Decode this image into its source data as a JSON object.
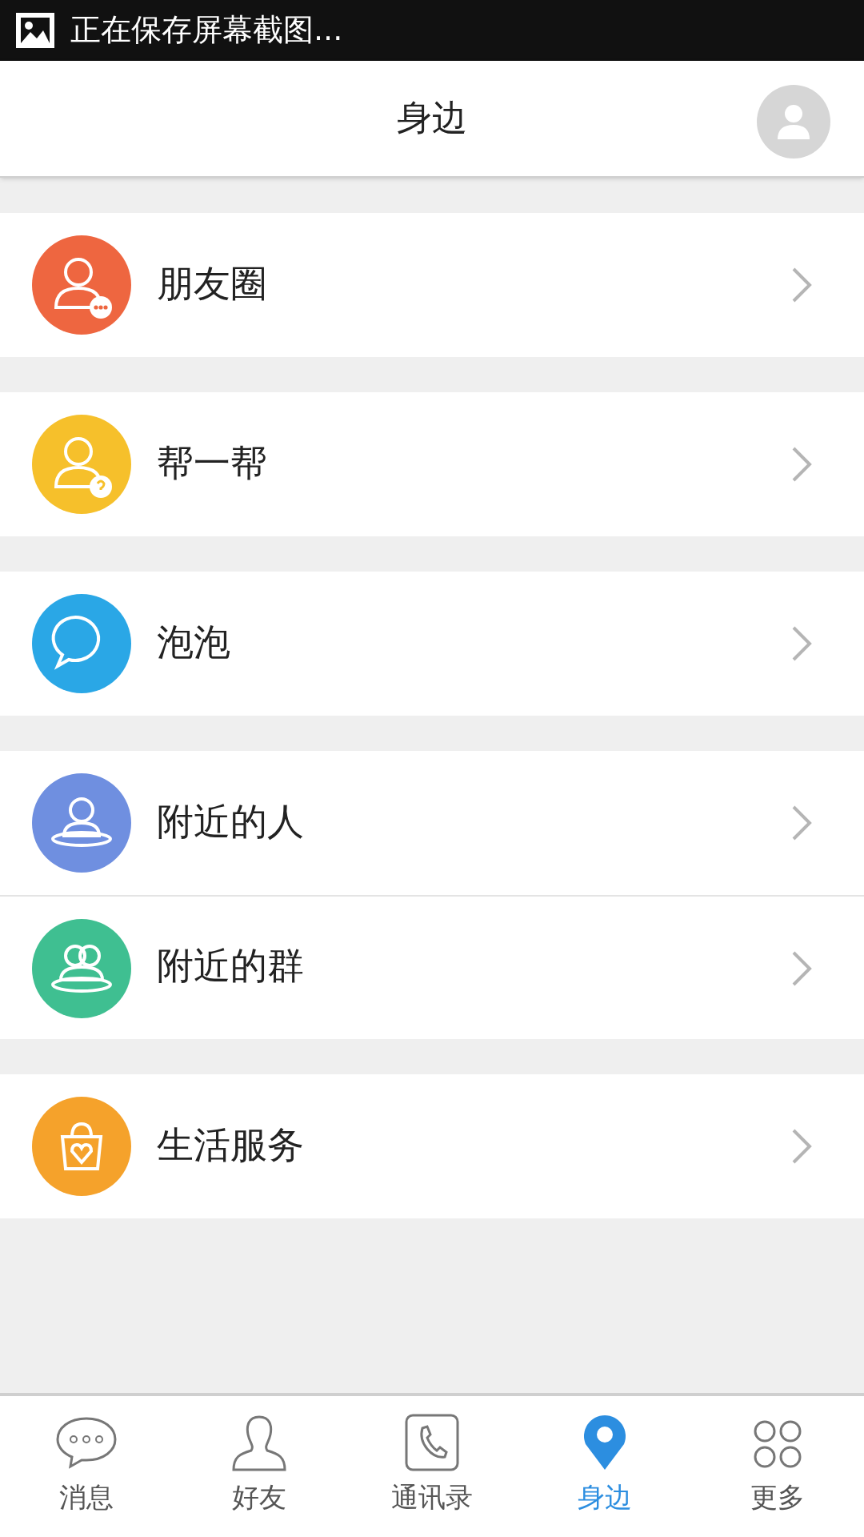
{
  "status_bar": {
    "text": "正在保存屏幕截图..."
  },
  "header": {
    "title": "身边"
  },
  "groups": [
    [
      {
        "kind": "moments",
        "label": "朋友圈",
        "color": "#ee6640"
      }
    ],
    [
      {
        "kind": "help",
        "label": "帮一帮",
        "color": "#f6c02b"
      }
    ],
    [
      {
        "kind": "bubble",
        "label": "泡泡",
        "color": "#2aa7e6"
      }
    ],
    [
      {
        "kind": "people",
        "label": "附近的人",
        "color": "#6f8fe0"
      },
      {
        "kind": "groups",
        "label": "附近的群",
        "color": "#3fbf91"
      }
    ],
    [
      {
        "kind": "service",
        "label": "生活服务",
        "color": "#f5a22b"
      }
    ]
  ],
  "tabs": [
    {
      "kind": "chat",
      "label": "消息",
      "selected": false
    },
    {
      "kind": "friend",
      "label": "好友",
      "selected": false
    },
    {
      "kind": "phone",
      "label": "通讯录",
      "selected": false
    },
    {
      "kind": "pin",
      "label": "身边",
      "selected": true
    },
    {
      "kind": "more",
      "label": "更多",
      "selected": false
    }
  ]
}
